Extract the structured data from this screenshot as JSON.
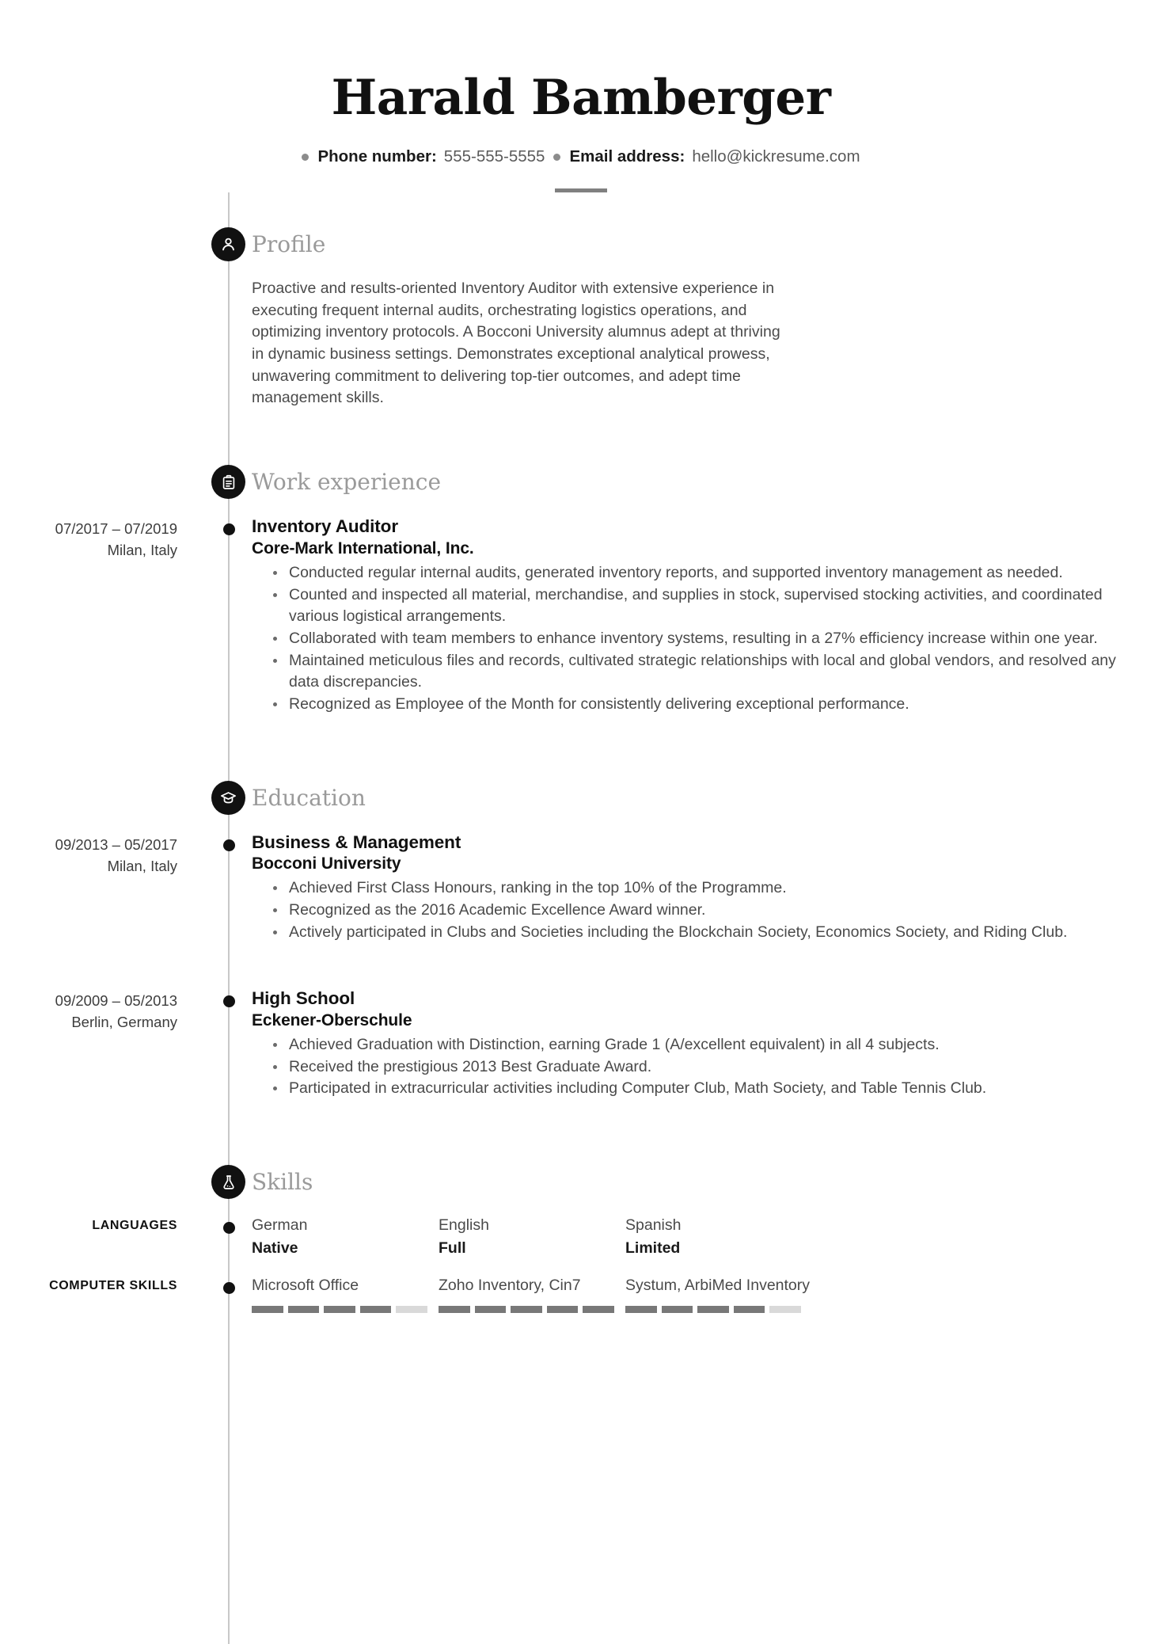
{
  "header": {
    "full_name": "Harald Bamberger",
    "contacts": [
      {
        "label": "Phone number:",
        "value": "555-555-5555"
      },
      {
        "label": "Email address:",
        "value": "hello@kickresume.com"
      }
    ]
  },
  "sections": {
    "profile": {
      "title": "Profile",
      "icon": "person-icon",
      "text": "Proactive and results-oriented Inventory Auditor with extensive experience in executing frequent internal audits, orchestrating logistics operations, and optimizing inventory protocols. A Bocconi University alumnus adept at thriving in dynamic business settings. Demonstrates exceptional analytical prowess, unwavering commitment to delivering top-tier outcomes, and adept time management skills."
    },
    "work": {
      "title": "Work experience",
      "icon": "briefcase-icon",
      "entries": [
        {
          "date": "07/2017 – 07/2019",
          "place": "Milan, Italy",
          "title": "Inventory Auditor",
          "subtitle": "Core-Mark International, Inc.",
          "bullets": [
            "Conducted regular internal audits, generated inventory reports, and supported inventory management as needed.",
            "Counted and inspected all material, merchandise, and supplies in stock, supervised stocking activities, and coordinated various logistical arrangements.",
            "Collaborated with team members to enhance inventory systems, resulting in a 27% efficiency increase within one year.",
            "Maintained meticulous files and records, cultivated strategic relationships with local and global vendors, and resolved any data discrepancies.",
            "Recognized as Employee of the Month for consistently delivering exceptional performance."
          ]
        }
      ]
    },
    "education": {
      "title": "Education",
      "icon": "graduation-cap-icon",
      "entries": [
        {
          "date": "09/2013 – 05/2017",
          "place": "Milan, Italy",
          "title": "Business & Management",
          "subtitle": "Bocconi University",
          "bullets": [
            "Achieved First Class Honours, ranking in the top 10% of the Programme.",
            "Recognized as the 2016 Academic Excellence Award winner.",
            "Actively participated in Clubs and Societies including the Blockchain Society, Economics Society, and Riding Club."
          ]
        },
        {
          "date": "09/2009 – 05/2013",
          "place": "Berlin, Germany",
          "title": "High School",
          "subtitle": "Eckener-Oberschule",
          "bullets": [
            "Achieved Graduation with Distinction, earning Grade 1 (A/excellent equivalent) in all 4 subjects.",
            "Received the prestigious 2013 Best Graduate Award.",
            "Participated in extracurricular activities including Computer Club, Math Society, and Table Tennis Club."
          ]
        }
      ]
    },
    "skills": {
      "title": "Skills",
      "icon": "flask-icon",
      "languages": {
        "label": "LANGUAGES",
        "items": [
          {
            "name": "German",
            "level": "Native"
          },
          {
            "name": "English",
            "level": "Full"
          },
          {
            "name": "Spanish",
            "level": "Limited"
          }
        ]
      },
      "computer_skills": {
        "label": "COMPUTER SKILLS",
        "items": [
          {
            "name": "Microsoft Office",
            "rating": 4,
            "max": 5
          },
          {
            "name": "Zoho Inventory, Cin7",
            "rating": 5,
            "max": 5
          },
          {
            "name": "Systum, ArbiMed Inventory",
            "rating": 4,
            "max": 5
          }
        ]
      }
    }
  },
  "colors": {
    "accent_dark": "#111111",
    "timeline": "#c8c8c8",
    "heading_gray": "#9a9a9a",
    "body_gray": "#4a4a4a",
    "bar_on": "#787878",
    "bar_off": "#d9d9d9"
  }
}
